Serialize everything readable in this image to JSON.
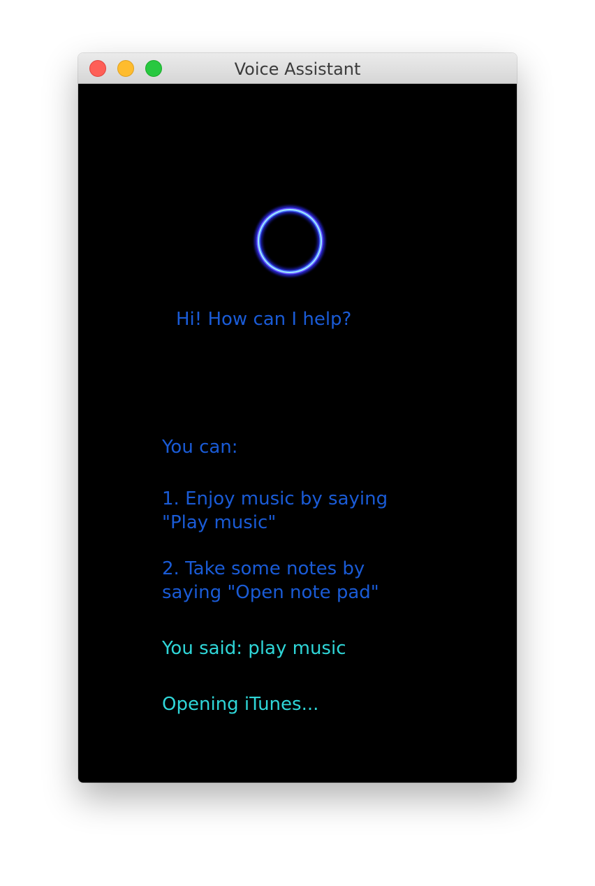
{
  "window": {
    "title": "Voice Assistant"
  },
  "assistant": {
    "greeting": "Hi! How can I help?",
    "intro": "You can:",
    "options": [
      "1. Enjoy music by saying \"Play music\"",
      "2. Take some notes by saying \"Open note pad\""
    ],
    "you_said": "You said: play music",
    "response": "Opening iTunes..."
  },
  "colors": {
    "background": "#000000",
    "prompt_text": "#1a5bd6",
    "status_text": "#2fd6d8",
    "orb_ring": "#5b8cff"
  },
  "icons": {
    "orb": "listening-orb-icon"
  }
}
